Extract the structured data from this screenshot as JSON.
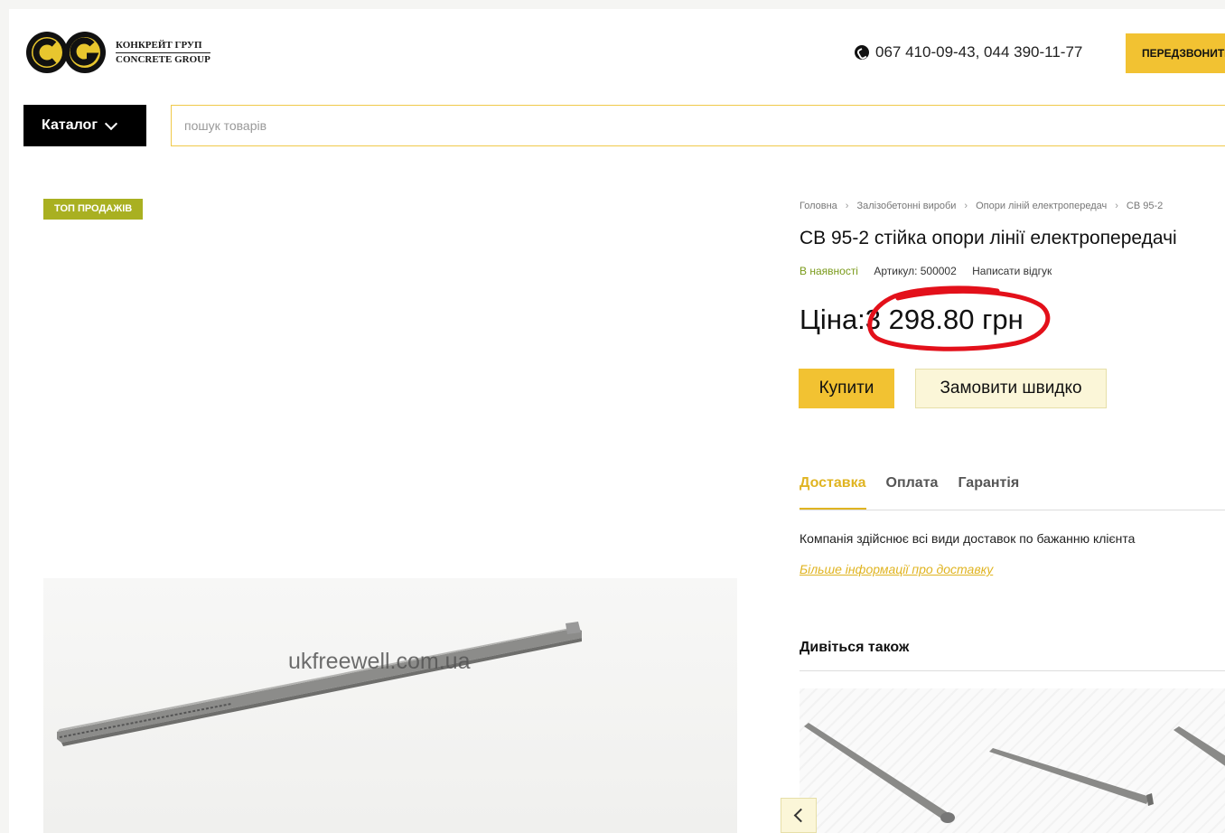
{
  "header": {
    "logo_line1": "КОНКРЕЙТ ГРУП",
    "logo_line2": "CONCRETE GROUP",
    "phones": "067 410-09-43,  044 390-11-77",
    "callback_label": "ПЕРЕДЗВОНИТИ"
  },
  "nav": {
    "catalog_label": "Каталог",
    "search_placeholder": "пошук товарів"
  },
  "product": {
    "badge": "ТОП ПРОДАЖІВ",
    "watermark": "ukfreewell.com.ua",
    "breadcrumb": [
      "Головна",
      "Залізобетонні вироби",
      "Опори ліній електропередач",
      "СВ 95-2"
    ],
    "title": "СВ 95-2 стійка опори лінії електропередачі",
    "stock": "В наявності",
    "article": "Артикул: 500002",
    "review_link": "Написати відгук",
    "price_label": "Ціна:",
    "price_value": "3 298.80 грн",
    "buy_label": "Купити",
    "quick_order_label": "Замовити швидко"
  },
  "info_tabs": {
    "tabs": [
      "Доставка",
      "Оплата",
      "Гарантія"
    ],
    "active": "Доставка",
    "delivery_text": "Компанія здійснює всі види доставок по бажанню клієнта",
    "delivery_link": "Більше інформації про доставку"
  },
  "see_also": {
    "title": "Дивіться також"
  },
  "colors": {
    "accent": "#f2c232",
    "badge": "#a9b021",
    "stock": "#7a9a1a",
    "annotation": "#e3101a"
  }
}
